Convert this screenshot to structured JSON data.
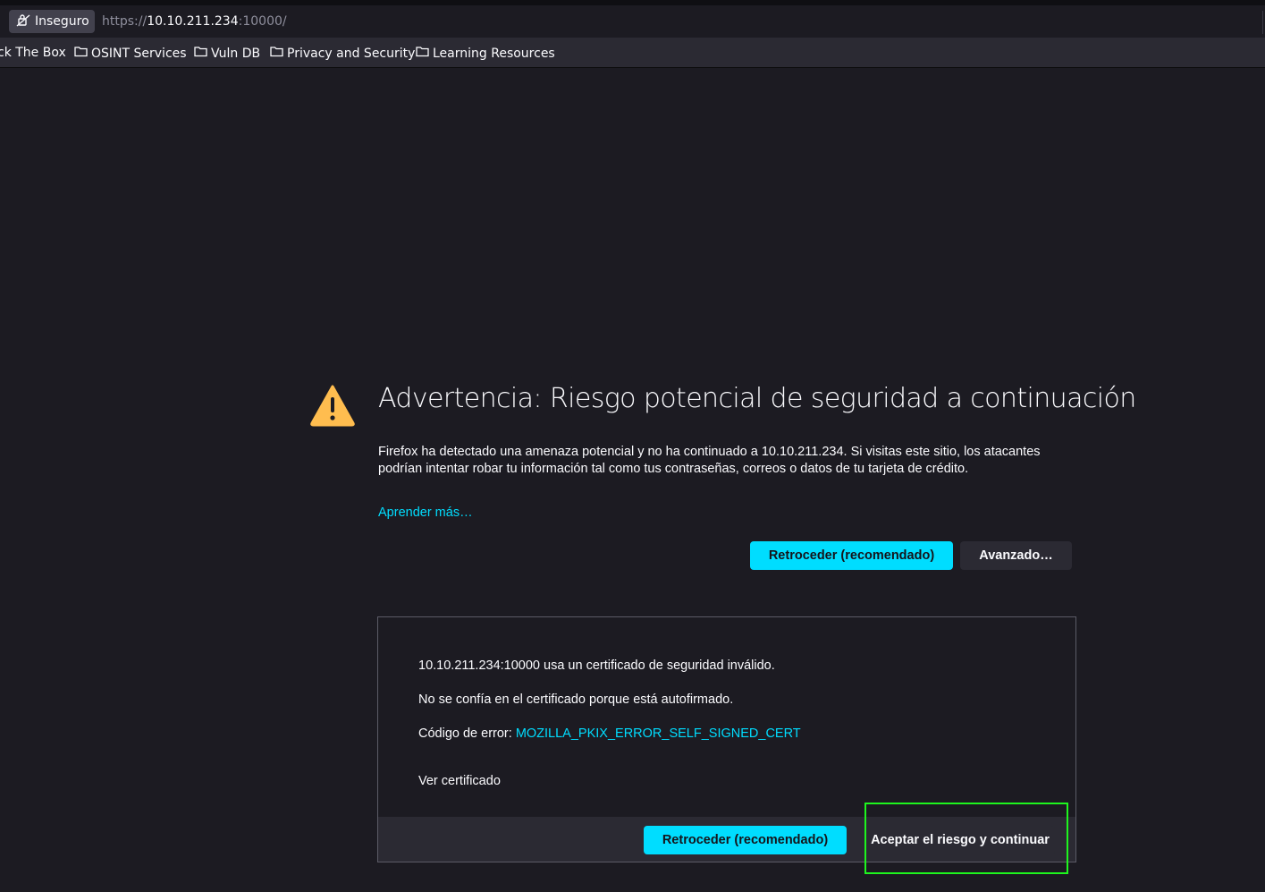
{
  "browser": {
    "identity_label": "Inseguro",
    "url_protocol": "https://",
    "url_host": "10.10.211.234",
    "url_port": ":10000/",
    "bookmarks": [
      {
        "label": "ck The Box",
        "icon": "none"
      },
      {
        "label": "OSINT Services",
        "icon": "folder-icon"
      },
      {
        "label": "Vuln DB",
        "icon": "folder-icon"
      },
      {
        "label": "Privacy and Security",
        "icon": "folder-icon"
      },
      {
        "label": "Learning Resources",
        "icon": "folder-icon"
      }
    ]
  },
  "error_page": {
    "title": "Advertencia: Riesgo potencial de seguridad a continuación",
    "description": "Firefox ha detectado una amenaza potencial y no ha continuado a 10.10.211.234. Si visitas este sitio, los atacantes podrían intentar robar tu información tal como tus contraseñas, correos o datos de tu tarjeta de crédito.",
    "learn_more": "Aprender más…",
    "go_back_button": "Retroceder (recomendado)",
    "advanced_button": "Avanzado…",
    "advanced": {
      "line1": "10.10.211.234:10000 usa un certificado de seguridad inválido.",
      "line2": "No se confía en el certificado porque está autofirmado.",
      "error_code_label": "Código de error: ",
      "error_code": "MOZILLA_PKIX_ERROR_SELF_SIGNED_CERT",
      "view_certificate": "Ver certificado",
      "go_back_button": "Retroceder (recomendado)",
      "accept_button": "Aceptar el riesgo y continuar"
    }
  },
  "colors": {
    "background": "#1c1b22",
    "accent": "#00ddff",
    "warning": "#ffbd4f",
    "highlight": "#1ef51e"
  }
}
